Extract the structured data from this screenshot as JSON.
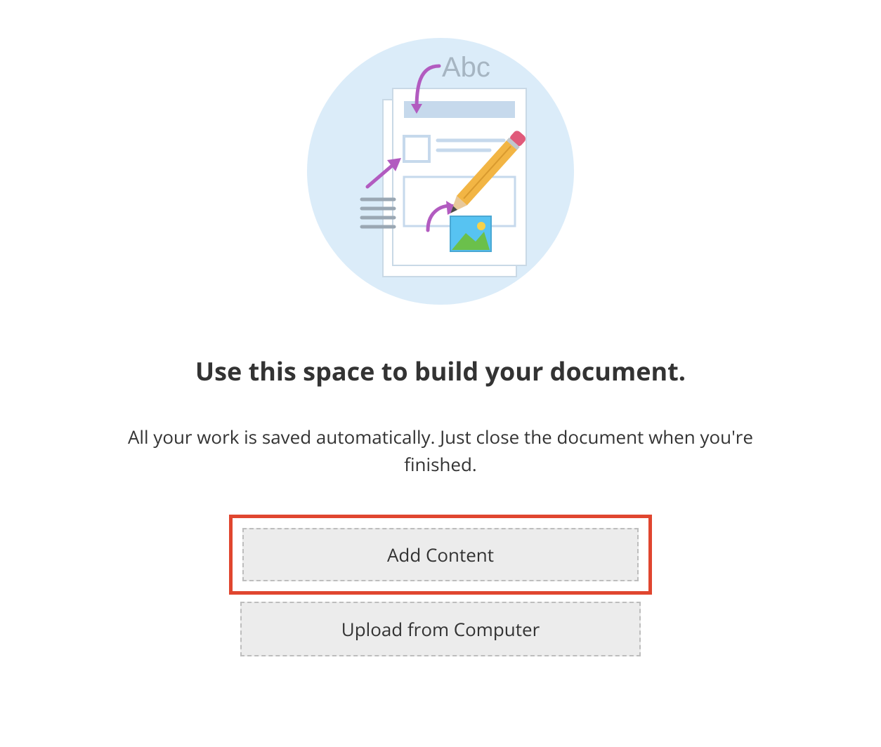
{
  "illustration": {
    "placeholder_text": "Abc"
  },
  "empty_state": {
    "heading": "Use this space to build your document.",
    "subtext": "All your work is saved automatically. Just close the document when you're finished."
  },
  "buttons": {
    "add_content": "Add Content",
    "upload": "Upload from Computer"
  },
  "colors": {
    "highlight_border": "#e0462f",
    "circle_bg": "#dbecf9",
    "button_bg": "#ececec",
    "button_border": "#bdbdbd"
  }
}
